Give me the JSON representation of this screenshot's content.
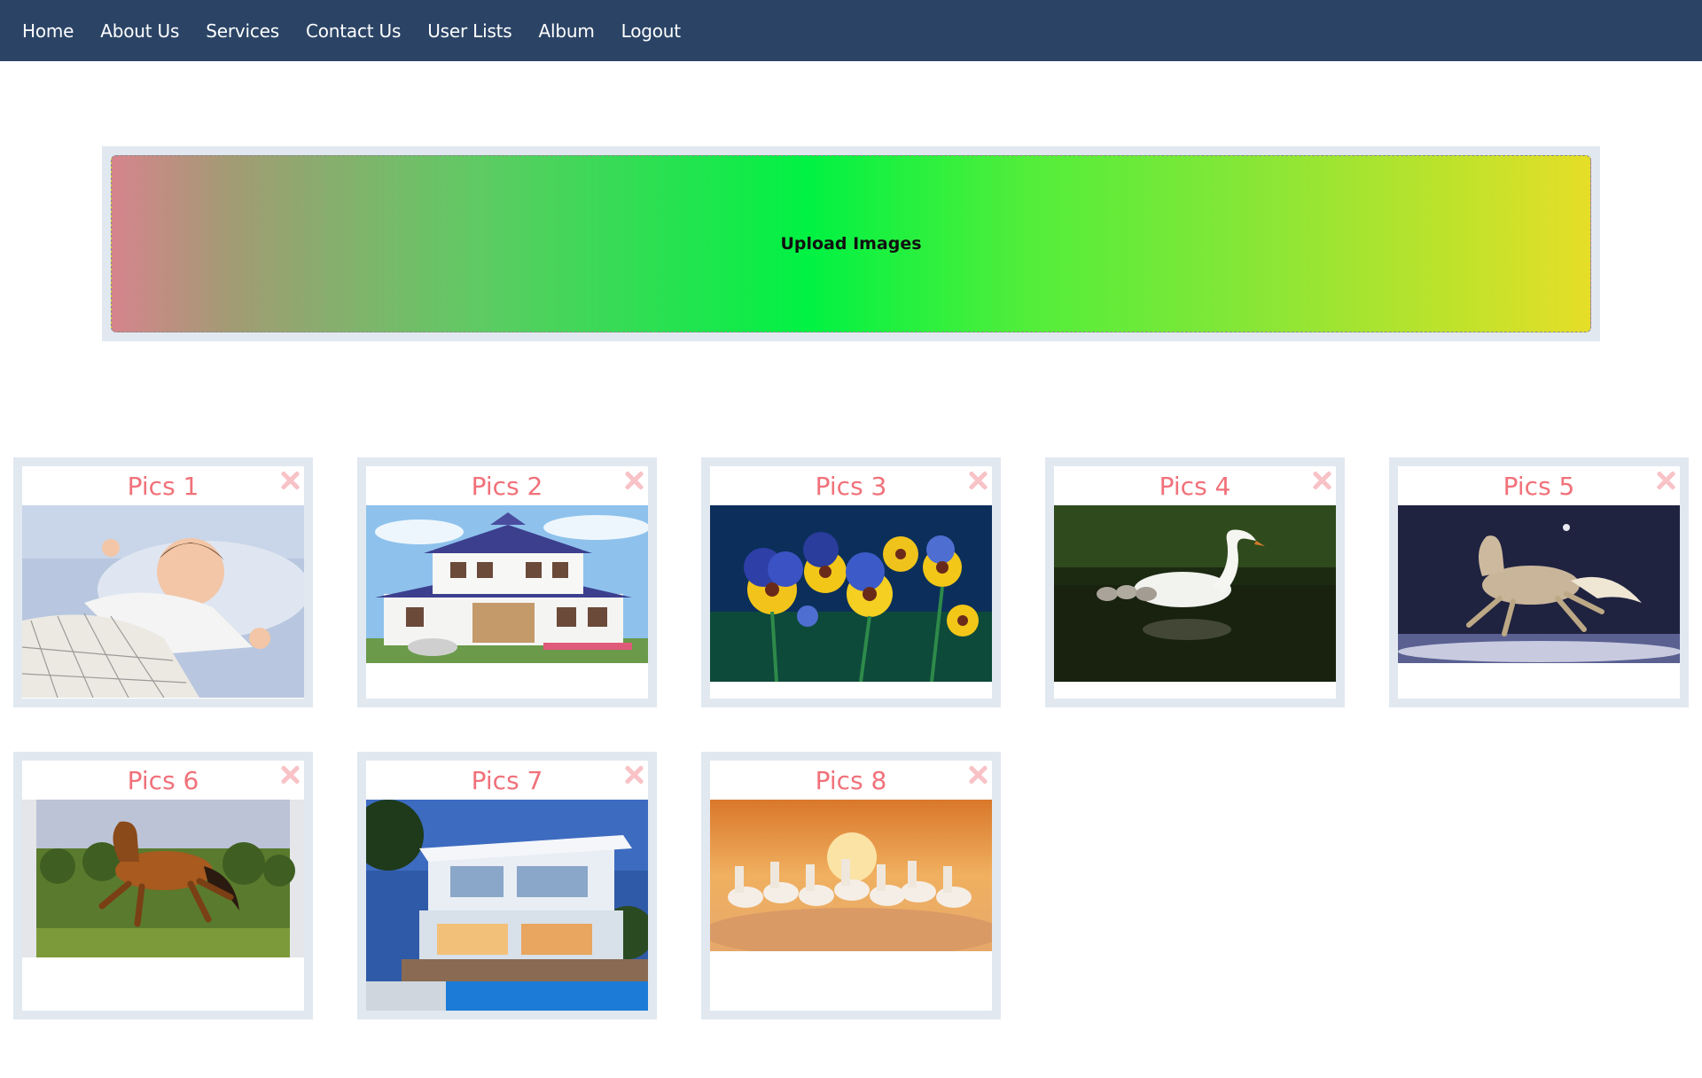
{
  "nav": {
    "items": [
      "Home",
      "About Us",
      "Services",
      "Contact Us",
      "User Lists",
      "Album",
      "Logout"
    ]
  },
  "upload": {
    "label": "Upload Images"
  },
  "gallery": {
    "cards": [
      {
        "title": "Pics 1",
        "image": "baby-sleeping"
      },
      {
        "title": "Pics 2",
        "image": "house"
      },
      {
        "title": "Pics 3",
        "image": "pansy-flowers"
      },
      {
        "title": "Pics 4",
        "image": "swan-with-cygnets"
      },
      {
        "title": "Pics 5",
        "image": "white-horse-night"
      },
      {
        "title": "Pics 6",
        "image": "brown-horse-galloping"
      },
      {
        "title": "Pics 7",
        "image": "modern-villa"
      },
      {
        "title": "Pics 8",
        "image": "seven-white-horses"
      }
    ]
  },
  "colors": {
    "navbar": "#2b4466",
    "card_title": "#f0717a",
    "close_icon": "#f8c2c6",
    "card_frame": "#e1e8f0"
  }
}
